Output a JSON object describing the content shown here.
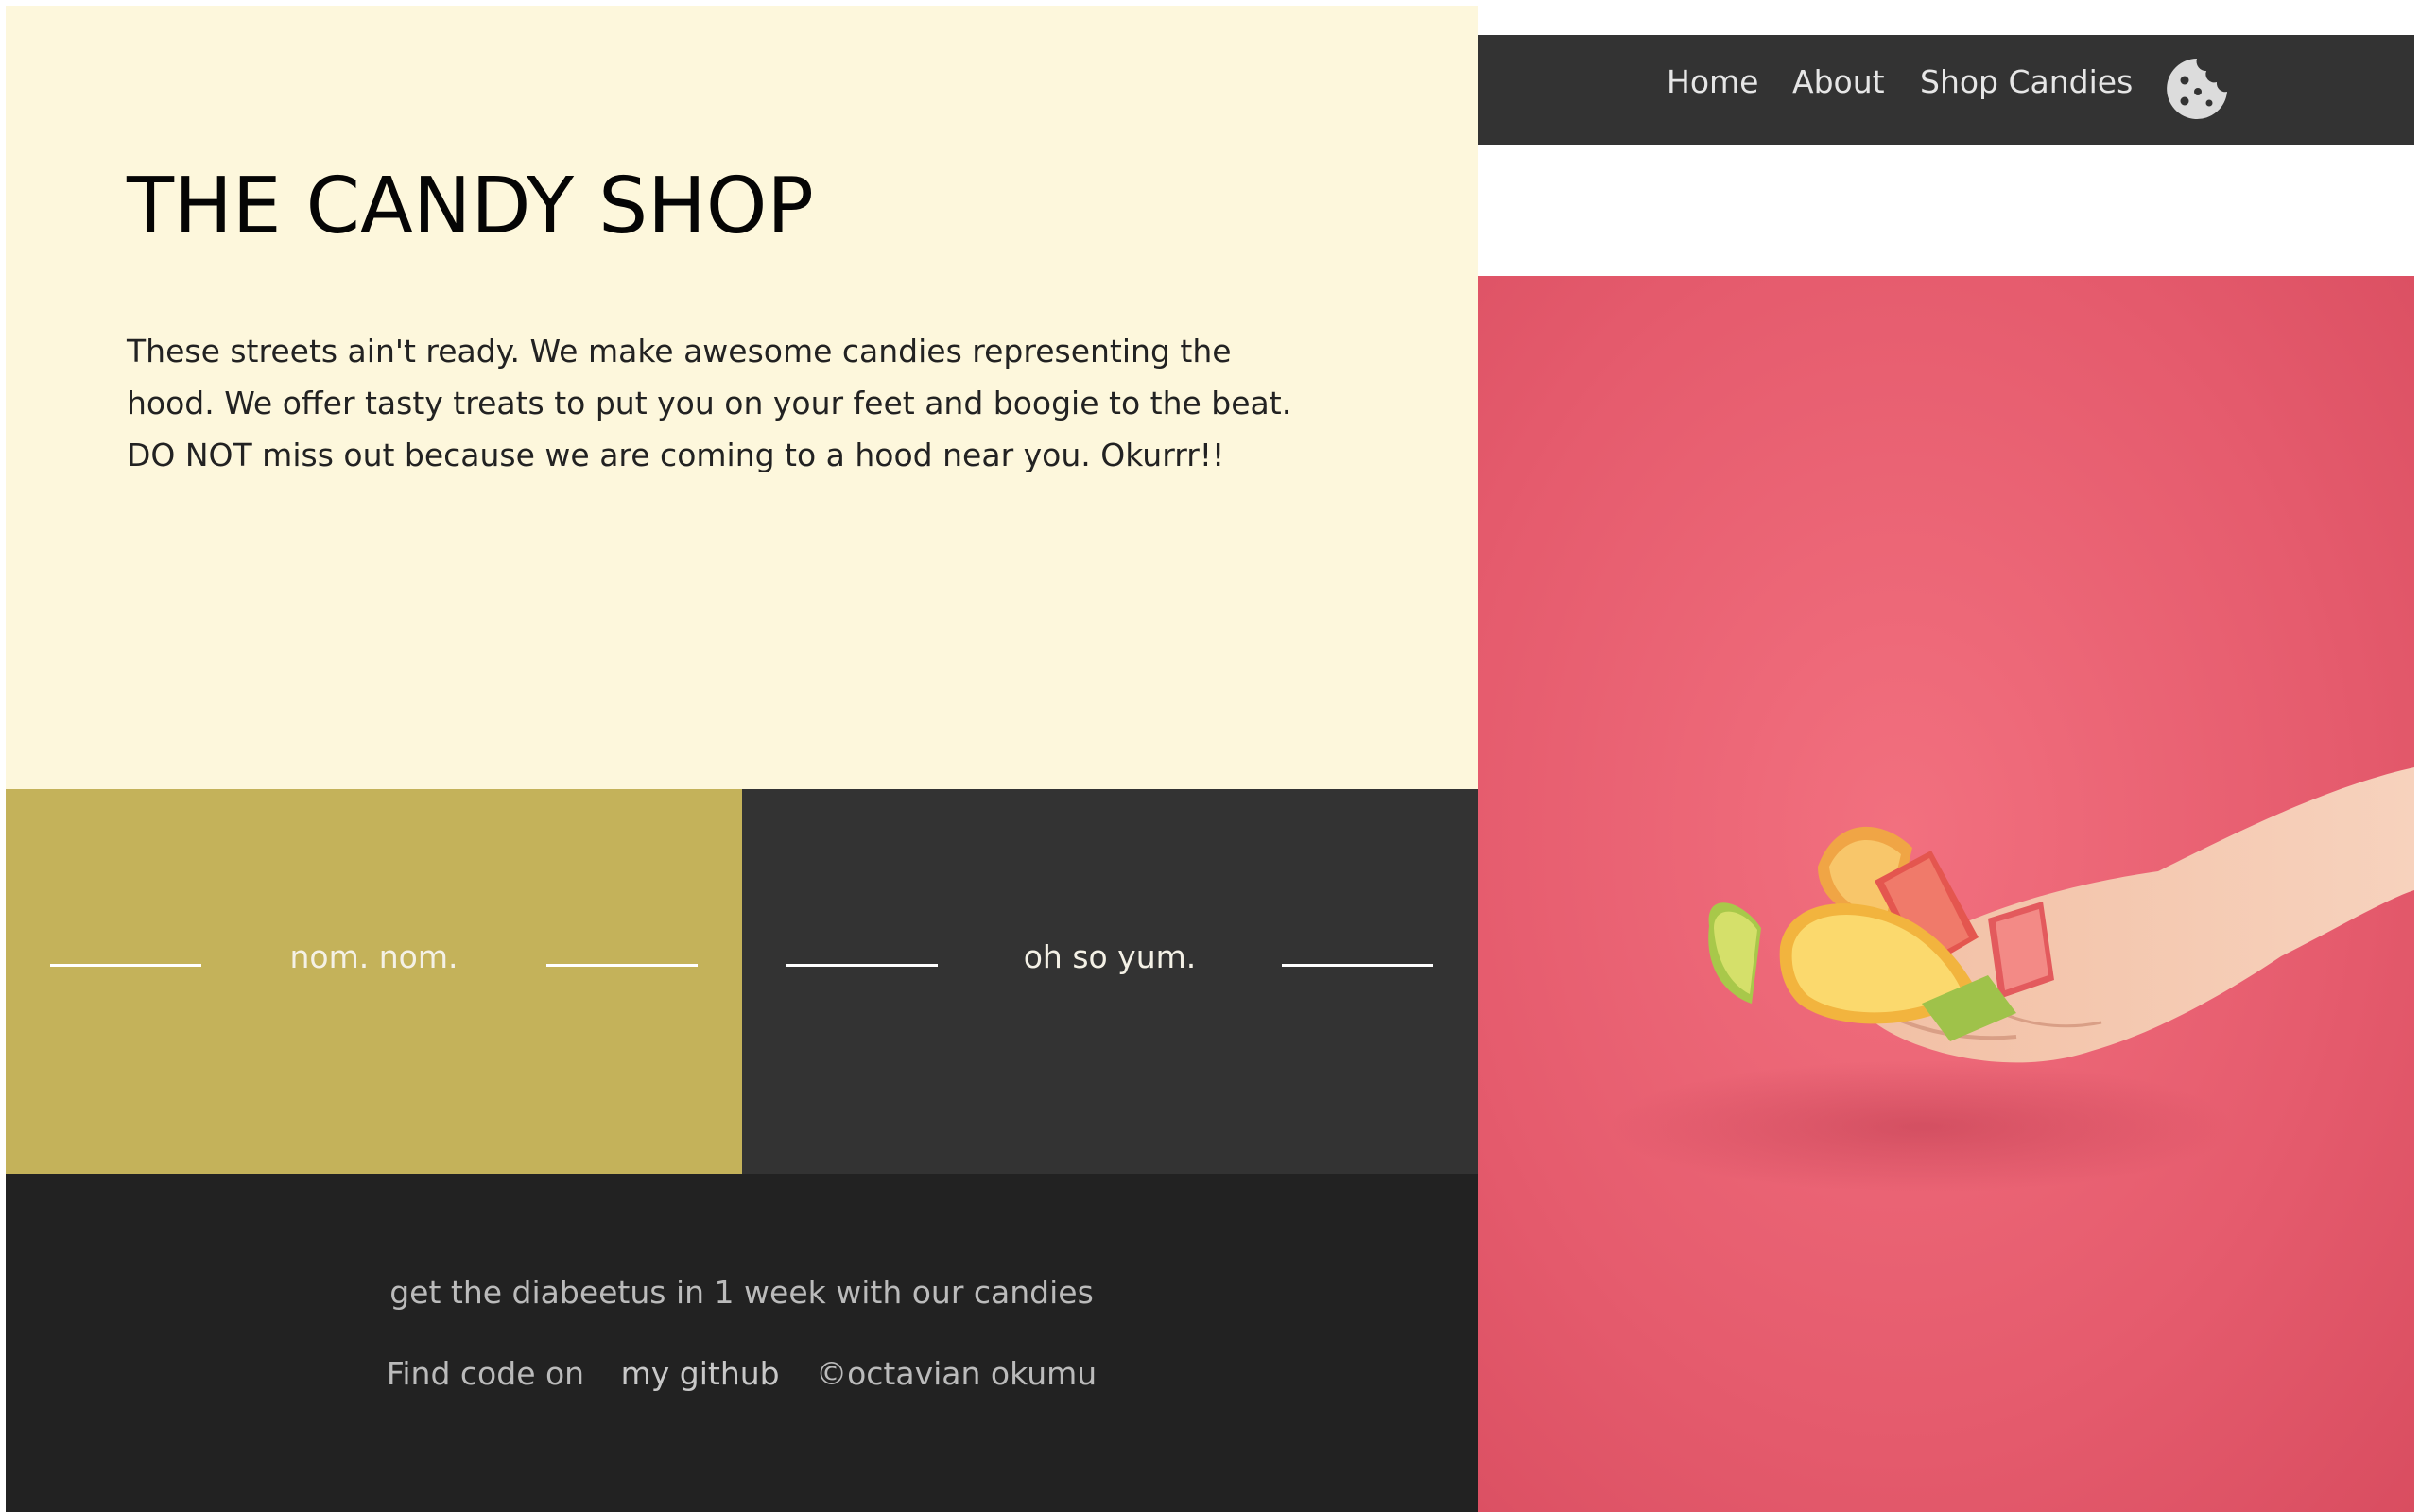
{
  "hero": {
    "title": "THE CANDY SHOP",
    "description": "These streets ain't ready. We make awesome candies representing the hood. We offer tasty treats to put you on your feet and boogie to the beat. DO NOT miss out because we are coming to a hood near you. Okurrr!!"
  },
  "tiles": [
    {
      "label": "nom. nom."
    },
    {
      "label": "oh so yum."
    }
  ],
  "footer": {
    "tagline": "get the diabeetus in 1 week with our candies",
    "find_code": "Find code on",
    "github_link": "my github",
    "copyright": "©octavian okumu"
  },
  "nav": {
    "items": [
      {
        "label": "Home"
      },
      {
        "label": "About"
      },
      {
        "label": "Shop Candies"
      }
    ],
    "cart_icon": "cookie-icon"
  },
  "colors": {
    "hero_bg": "#fdf7dc",
    "tile_yellow": "#c4b25a",
    "tile_dark": "#333333",
    "footer_bg": "#222222",
    "nav_bg": "#333333",
    "photo_bg": "#e65a6c"
  }
}
